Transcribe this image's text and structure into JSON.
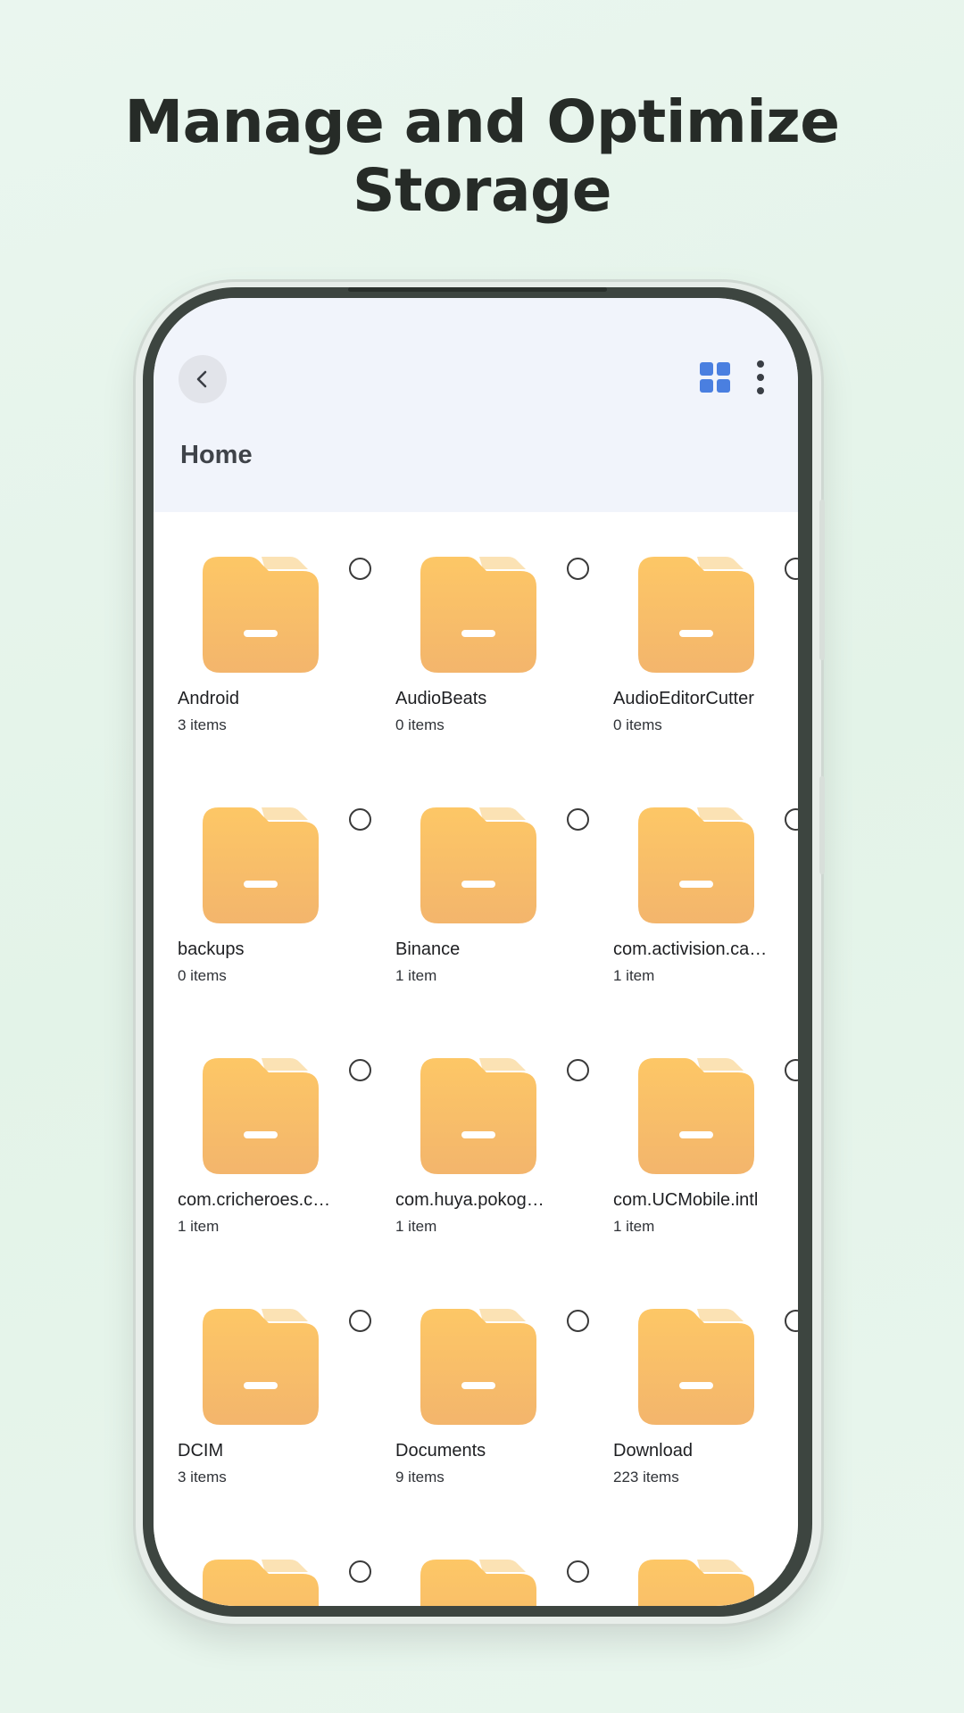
{
  "headline": "Manage and Optimize Storage",
  "header": {
    "title": "Home",
    "back_icon": "chevron-left-icon",
    "view_toggle_icon": "grid-view-icon",
    "menu_icon": "more-vertical-icon"
  },
  "colors": {
    "folder": "#f8bf5e",
    "accent": "#4a7fe0",
    "topbar_bg": "#f1f4fb"
  },
  "folders": [
    {
      "name": "Android",
      "count": "3 items"
    },
    {
      "name": "AudioBeats",
      "count": "0 items"
    },
    {
      "name": "AudioEditorCutter",
      "count": "0 items"
    },
    {
      "name": "backups",
      "count": "0 items"
    },
    {
      "name": "Binance",
      "count": "1 item"
    },
    {
      "name": "com.activision.ca…",
      "count": "1 item"
    },
    {
      "name": "com.cricheroes.c…",
      "count": "1 item"
    },
    {
      "name": "com.huya.pokog…",
      "count": "1 item"
    },
    {
      "name": "com.UCMobile.intl",
      "count": "1 item"
    },
    {
      "name": "DCIM",
      "count": "3 items"
    },
    {
      "name": "Documents",
      "count": "9 items"
    },
    {
      "name": "Download",
      "count": "223 items"
    },
    {
      "name": "",
      "count": ""
    },
    {
      "name": "",
      "count": ""
    },
    {
      "name": "",
      "count": ""
    }
  ]
}
